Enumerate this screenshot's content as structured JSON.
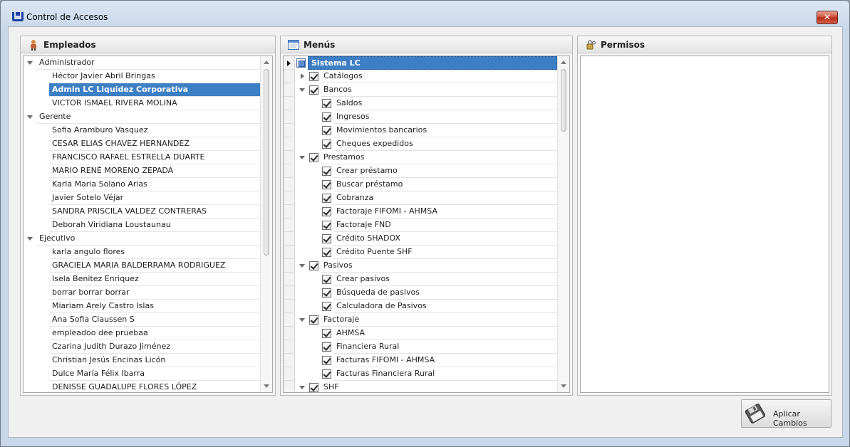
{
  "window": {
    "title": "Control de Accesos",
    "close_label": "✕"
  },
  "panels": {
    "empleados": {
      "title": "Empleados"
    },
    "menus": {
      "title": "Menús"
    },
    "permisos": {
      "title": "Permisos"
    }
  },
  "employees": [
    {
      "type": "group",
      "label": "Administrador"
    },
    {
      "type": "item",
      "label": "Héctor Javier Abril Bringas"
    },
    {
      "type": "item",
      "label": "Admin LC Liquidez Corporativa",
      "selected": true
    },
    {
      "type": "item",
      "label": "VICTOR ISMAEL RIVERA MOLINA"
    },
    {
      "type": "group",
      "label": "Gerente"
    },
    {
      "type": "item",
      "label": "Sofia Aramburo Vasquez"
    },
    {
      "type": "item",
      "label": "CESAR ELIAS CHAVEZ HERNANDEZ"
    },
    {
      "type": "item",
      "label": "FRANCISCO RAFAEL ESTRELLA DUARTE"
    },
    {
      "type": "item",
      "label": "MARIO RENÉ MORENO ZEPADA"
    },
    {
      "type": "item",
      "label": "Karla Maria Solano Arias"
    },
    {
      "type": "item",
      "label": "Javier  Sotelo Véjar"
    },
    {
      "type": "item",
      "label": "SANDRA PRISCILA VALDEZ CONTRERAS"
    },
    {
      "type": "item",
      "label": "Deborah Viridiana Loustaunau"
    },
    {
      "type": "group",
      "label": "Ejecutivo"
    },
    {
      "type": "item",
      "label": "karla angulo flores"
    },
    {
      "type": "item",
      "label": "GRACIELA MARIA BALDERRAMA RODRIGUEZ"
    },
    {
      "type": "item",
      "label": "Isela Benitez Enriquez"
    },
    {
      "type": "item",
      "label": "borrar borrar borrar"
    },
    {
      "type": "item",
      "label": "Miariam Arely Castro Islas"
    },
    {
      "type": "item",
      "label": "Ana Sofia Claussen S"
    },
    {
      "type": "item",
      "label": "empleadoo dee pruebaa"
    },
    {
      "type": "item",
      "label": "Czarina Judith Durazo Jiménez"
    },
    {
      "type": "item",
      "label": "Christian Jesús Encinas Licón"
    },
    {
      "type": "item",
      "label": "Dulce María Félix Ibarra"
    },
    {
      "type": "item",
      "label": "DENISSE GUADALUPE FLORES LÓPEZ"
    }
  ],
  "menus": [
    {
      "level": 0,
      "label": "Sistema LC",
      "state": "indeterminate",
      "root": true
    },
    {
      "level": 1,
      "label": "Catálogos",
      "state": "checked",
      "expander": "collapsed"
    },
    {
      "level": 1,
      "label": "Bancos",
      "state": "checked",
      "expander": "expanded"
    },
    {
      "level": 2,
      "label": "Saldos",
      "state": "checked"
    },
    {
      "level": 2,
      "label": "Ingresos",
      "state": "checked"
    },
    {
      "level": 2,
      "label": "Movimientos bancarios",
      "state": "checked"
    },
    {
      "level": 2,
      "label": "Cheques expedidos",
      "state": "checked"
    },
    {
      "level": 1,
      "label": "Prestamos",
      "state": "checked",
      "expander": "expanded"
    },
    {
      "level": 2,
      "label": "Crear préstamo",
      "state": "checked"
    },
    {
      "level": 2,
      "label": "Buscar préstamo",
      "state": "checked"
    },
    {
      "level": 2,
      "label": "Cobranza",
      "state": "checked"
    },
    {
      "level": 2,
      "label": "Factoraje FIFOMI - AHMSA",
      "state": "checked"
    },
    {
      "level": 2,
      "label": "Factoraje FND",
      "state": "checked"
    },
    {
      "level": 2,
      "label": "Crédito SHADOX",
      "state": "checked"
    },
    {
      "level": 2,
      "label": "Crédito Puente SHF",
      "state": "checked"
    },
    {
      "level": 1,
      "label": "Pasivos",
      "state": "checked",
      "expander": "expanded"
    },
    {
      "level": 2,
      "label": "Crear pasivos",
      "state": "checked"
    },
    {
      "level": 2,
      "label": "Búsqueda de pasivos",
      "state": "checked"
    },
    {
      "level": 2,
      "label": "Calculadora de Pasivos",
      "state": "checked"
    },
    {
      "level": 1,
      "label": "Factoraje",
      "state": "checked",
      "expander": "expanded"
    },
    {
      "level": 2,
      "label": "AHMSA",
      "state": "checked"
    },
    {
      "level": 2,
      "label": "Financiera Rural",
      "state": "checked"
    },
    {
      "level": 2,
      "label": "Facturas FIFOMI - AHMSA",
      "state": "checked"
    },
    {
      "level": 2,
      "label": "Facturas Financiera Rural",
      "state": "checked"
    },
    {
      "level": 1,
      "label": "SHF",
      "state": "checked",
      "expander": "expanded"
    }
  ],
  "actions": {
    "apply_label": "Aplicar Cambios"
  },
  "colors": {
    "selection": "#3d7fc5",
    "panel_bg": "#f4f4f4",
    "window_frame": "#c8d8ea"
  }
}
